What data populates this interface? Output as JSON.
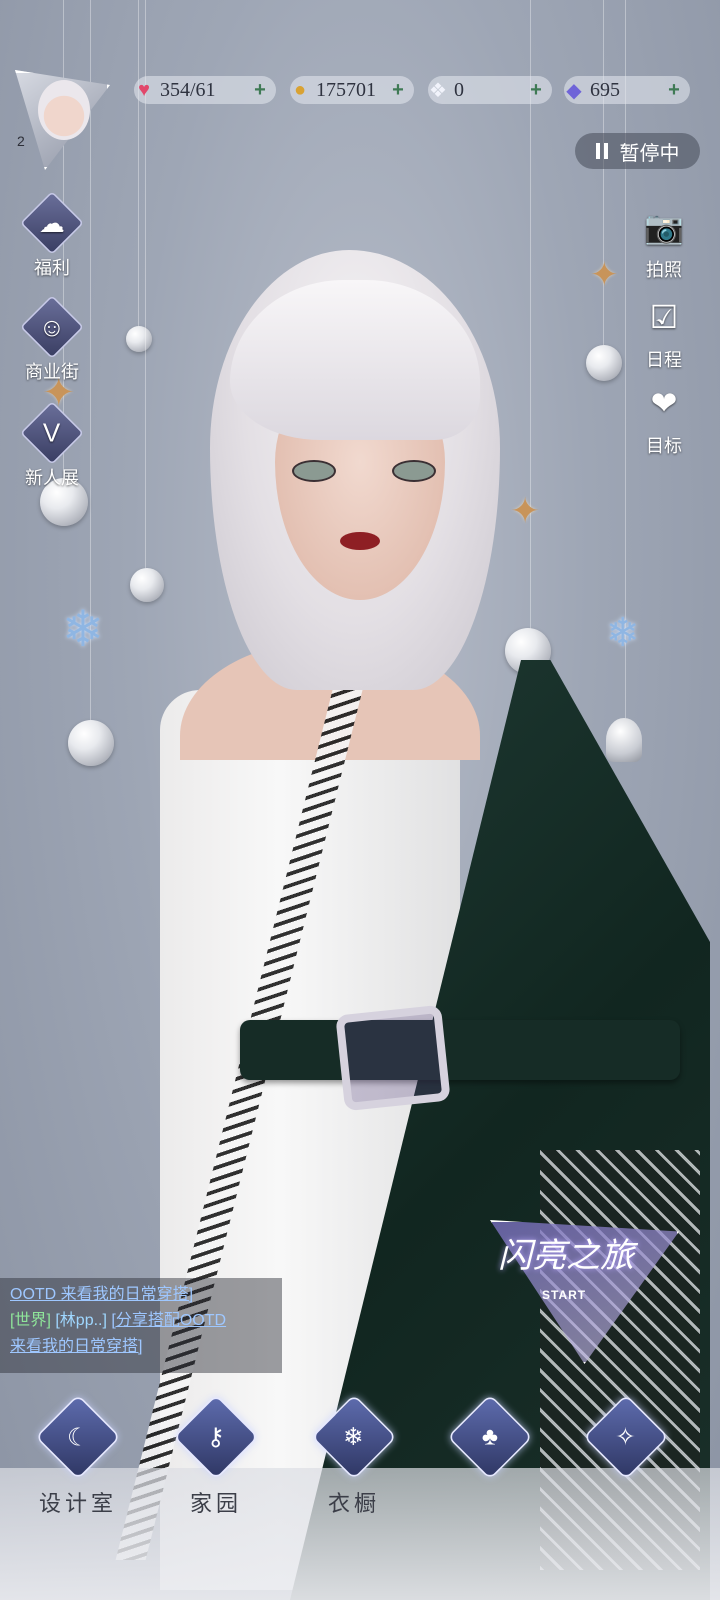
{
  "player": {
    "level": "2"
  },
  "resources": {
    "stamina": {
      "value": "354/61",
      "icon": "heart-gem-icon"
    },
    "gold": {
      "value": "175701",
      "icon": "gold-coin-icon"
    },
    "crystal": {
      "value": "0",
      "icon": "crystal-shard-icon"
    },
    "diamond": {
      "value": "695",
      "icon": "diamond-icon"
    }
  },
  "pause": {
    "label": "暂停中"
  },
  "left_menu": [
    {
      "label": "福利",
      "icon": "balloon-icon"
    },
    {
      "label": "商业街",
      "icon": "shopping-bag-icon"
    },
    {
      "label": "新人展",
      "icon": "crown-v-icon"
    }
  ],
  "right_menu": [
    {
      "label": "拍照",
      "icon": "camera-icon"
    },
    {
      "label": "日程",
      "icon": "calendar-check-icon"
    },
    {
      "label": "目标",
      "icon": "target-badge-icon"
    }
  ],
  "chat": {
    "line1": "OOTD 来看我的日常穿搭]",
    "channel": "[世界]",
    "user": "[林pp..]",
    "line2": "[分享搭配OOTD",
    "line3": "来看我的日常穿搭]"
  },
  "event_badge": {
    "title": "闪亮之旅",
    "subtitle": "START"
  },
  "bottom_nav": [
    {
      "label": "设计室",
      "icon": "moon-icon"
    },
    {
      "label": "家园",
      "icon": "key-icon"
    },
    {
      "label": "衣橱",
      "icon": "snowflake-icon"
    },
    {
      "label": "",
      "icon": "clover-icon"
    },
    {
      "label": "",
      "icon": "butterfly-icon"
    }
  ]
}
